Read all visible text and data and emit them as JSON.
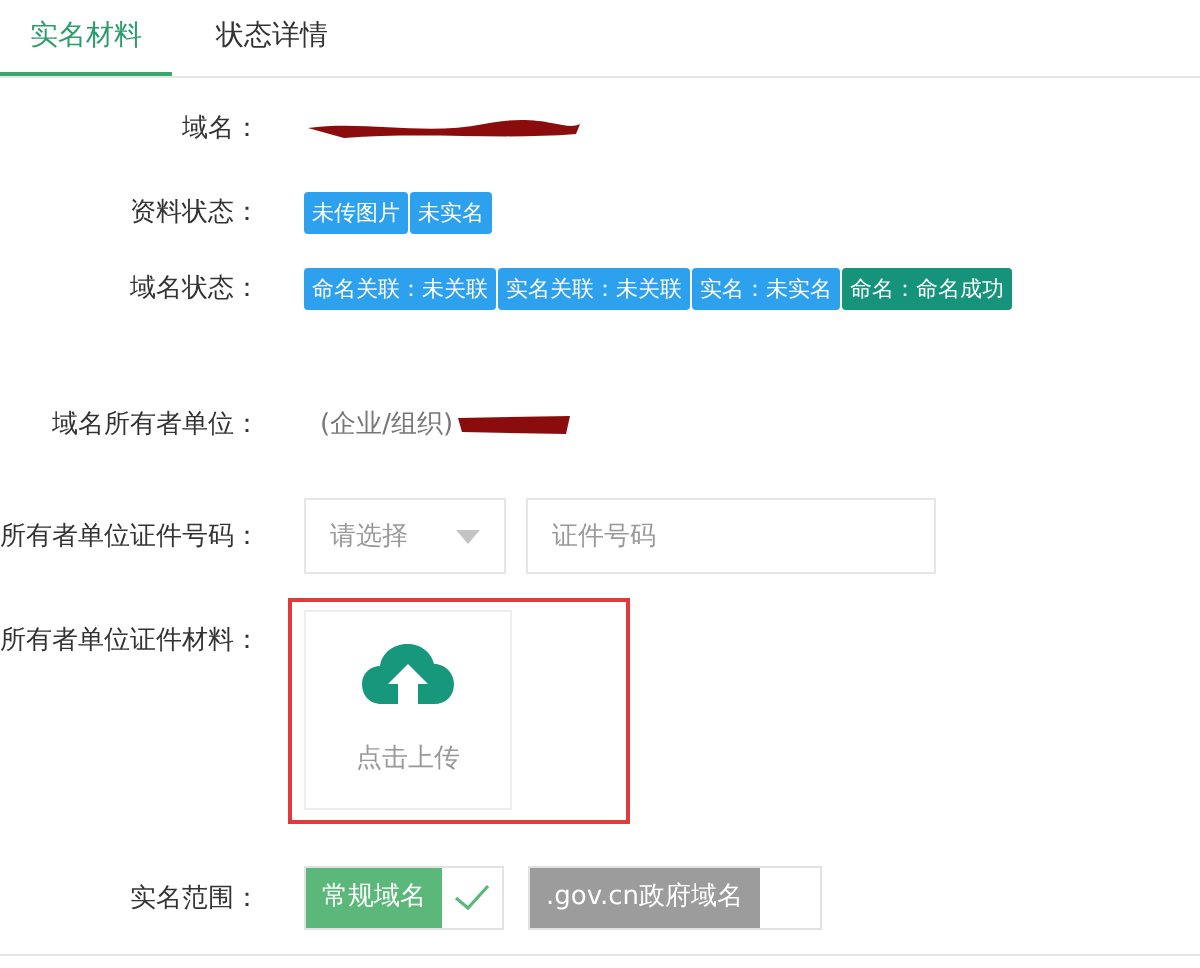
{
  "tabs": [
    {
      "label": "实名材料",
      "selected": true
    },
    {
      "label": "状态详情",
      "selected": false
    }
  ],
  "form": {
    "domain": {
      "label": "域名："
    },
    "data_status": {
      "label": "资料状态：",
      "tags": [
        {
          "text": "未传图片",
          "color": "#2ea1ee"
        },
        {
          "text": "未实名",
          "color": "#2ea1ee"
        }
      ]
    },
    "domain_status": {
      "label": "域名状态：",
      "tags": [
        {
          "text": "命名关联：未关联",
          "color": "#2ea1ee"
        },
        {
          "text": "实名关联：未关联",
          "color": "#2ea1ee"
        },
        {
          "text": "实名：未实名",
          "color": "#2ea1ee"
        },
        {
          "text": "命名：命名成功",
          "color": "#15937b"
        }
      ]
    },
    "owner": {
      "label": "域名所有者单位：",
      "value": "(企业/组织)"
    },
    "id_number": {
      "label": "所有者单位证件号码：",
      "select": {
        "placeholder": "请选择"
      },
      "input": {
        "placeholder": "证件号码"
      }
    },
    "materials": {
      "label": "所有者单位证件材料：",
      "upload": {
        "text": "点击上传"
      }
    },
    "scope": {
      "label": "实名范围：",
      "options": [
        {
          "text": "常规域名",
          "selected": true
        },
        {
          "text": ".gov.cn政府域名",
          "selected": false
        }
      ]
    }
  }
}
